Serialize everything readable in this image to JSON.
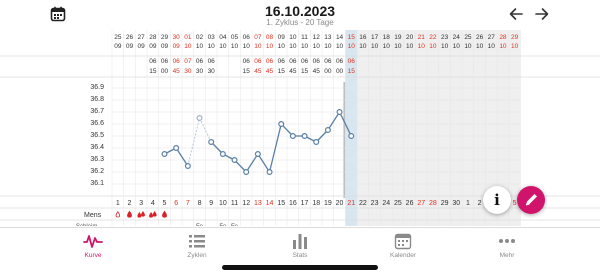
{
  "header": {
    "title": "16.10.2023",
    "subtitle": "1. Zyklus - 20 Tage"
  },
  "icons": {
    "calendar_button": "calendar-icon",
    "back": "arrow-left-icon",
    "forward": "arrow-right-icon",
    "info": "info-icon",
    "edit": "pencil-icon"
  },
  "colors": {
    "accent": "#d1146b",
    "line": "#5a7fa6",
    "red_text": "#e0301e",
    "today_band": "#d8e6f0",
    "future_band": "#efefef",
    "grid": "#e3e3e3"
  },
  "dates": {
    "day": [
      "25",
      "26",
      "27",
      "28",
      "29",
      "30",
      "01",
      "02",
      "03",
      "04",
      "05",
      "06",
      "07",
      "08",
      "09",
      "10",
      "11",
      "12",
      "13",
      "14",
      "15",
      "16",
      "17",
      "18",
      "19",
      "20",
      "21",
      "22",
      "23",
      "24",
      "25",
      "26",
      "27",
      "28",
      "29"
    ],
    "month": [
      "09",
      "09",
      "09",
      "09",
      "09",
      "09",
      "10",
      "10",
      "10",
      "10",
      "10",
      "10",
      "10",
      "10",
      "10",
      "10",
      "10",
      "10",
      "10",
      "10",
      "10",
      "10",
      "10",
      "10",
      "10",
      "10",
      "10",
      "10",
      "10",
      "10",
      "10",
      "10",
      "10",
      "10",
      "10"
    ],
    "red": [
      5,
      6,
      12,
      13,
      20,
      26,
      27,
      33,
      34
    ]
  },
  "times": {
    "hours": [
      "",
      "",
      "",
      "06",
      "06",
      "06",
      "07",
      "06",
      "06",
      "",
      "",
      "06",
      "06",
      "06",
      "06",
      "06",
      "06",
      "06",
      "06",
      "06",
      "06"
    ],
    "minutes": [
      "",
      "",
      "",
      "15",
      "00",
      "45",
      "30",
      "30",
      "30",
      "",
      "",
      "15",
      "45",
      "45",
      "15",
      "45",
      "15",
      "45",
      "00",
      "00",
      "15"
    ],
    "red": [
      5,
      6,
      12,
      13,
      20
    ]
  },
  "mens_label": "Mens",
  "mens_symbols": [
    "drop-outline",
    "drop",
    "drops",
    "drops",
    "drop"
  ],
  "truncated_row": {
    "label": "Schleim",
    "cells": [
      "Fe",
      "Fe",
      "Fe"
    ]
  },
  "chart_data": {
    "type": "line",
    "title": "",
    "xlabel": "",
    "ylabel": "",
    "y_ticks": [
      "36.9",
      "36.8",
      "36.7",
      "36.6",
      "36.5",
      "36.4",
      "36.3",
      "36.2",
      "36.1"
    ],
    "ylim": [
      36.0,
      36.95
    ],
    "cycle_days": [
      "1",
      "2",
      "3",
      "4",
      "5",
      "6",
      "7",
      "8",
      "9",
      "10",
      "11",
      "12",
      "13",
      "14",
      "15",
      "16",
      "17",
      "18",
      "19",
      "20",
      "21",
      "22",
      "23",
      "24",
      "25",
      "26",
      "27",
      "28",
      "29",
      "30",
      "1",
      "2",
      "3",
      "4",
      "5"
    ],
    "red_cycle_days": [
      5,
      6,
      12,
      13,
      20,
      26,
      27,
      33,
      34
    ],
    "today_index": 20,
    "series": [
      {
        "x": [
          4,
          5,
          6,
          7,
          8,
          9,
          10,
          11,
          12,
          13,
          14,
          15,
          16,
          17,
          18,
          19,
          20
        ],
        "y": [
          36.35,
          36.4,
          36.25,
          36.65,
          36.45,
          36.35,
          36.3,
          36.2,
          36.35,
          36.2,
          36.6,
          36.5,
          36.5,
          36.45,
          36.55,
          36.7,
          36.5
        ],
        "excluded": [
          7
        ]
      }
    ]
  },
  "tabs": [
    {
      "label": "Kurve",
      "icon": "curve-icon",
      "active": true
    },
    {
      "label": "Zyklen",
      "icon": "list-icon",
      "active": false
    },
    {
      "label": "Stats",
      "icon": "bar-chart-icon",
      "active": false
    },
    {
      "label": "Kalender",
      "icon": "calendar-icon",
      "active": false
    },
    {
      "label": "Mehr",
      "icon": "more-icon",
      "active": false
    }
  ]
}
